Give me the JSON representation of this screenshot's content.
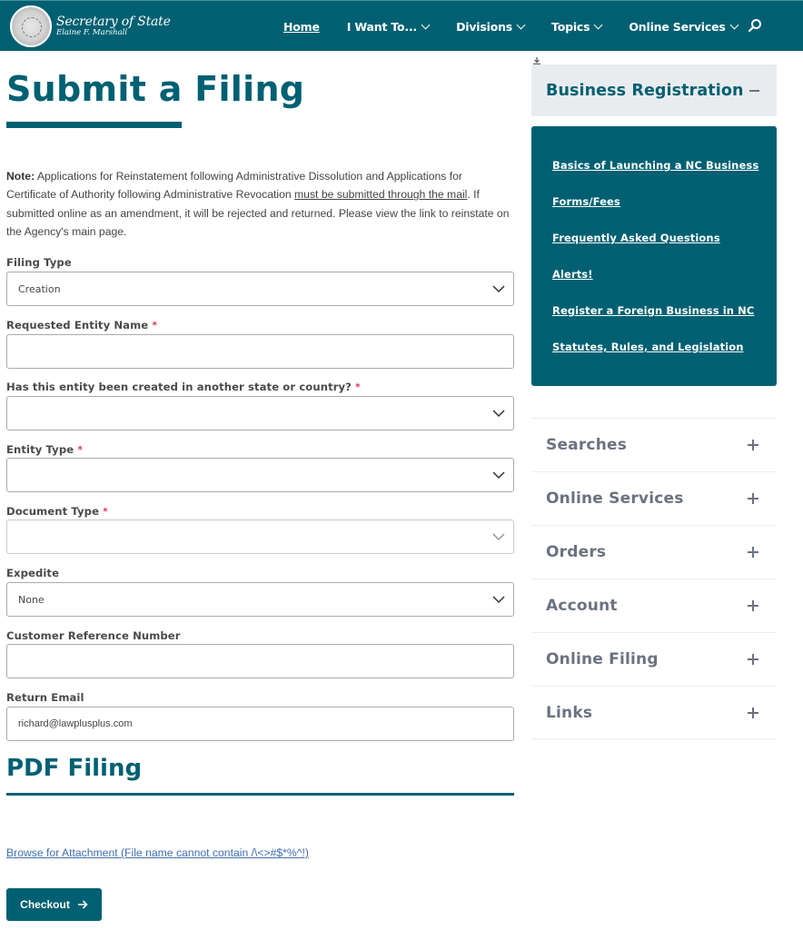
{
  "header": {
    "logo_title": "Secretary of State",
    "logo_subtitle": "Elaine F. Marshall",
    "brand_color": "#006072",
    "nav": [
      {
        "label": "Home",
        "active": true,
        "has_dropdown": false
      },
      {
        "label": "I Want To...",
        "active": false,
        "has_dropdown": true
      },
      {
        "label": "Divisions",
        "active": false,
        "has_dropdown": true
      },
      {
        "label": "Topics",
        "active": false,
        "has_dropdown": true
      },
      {
        "label": "Online Services",
        "active": false,
        "has_dropdown": true
      }
    ],
    "search_icon": "search-icon"
  },
  "main": {
    "title": "Submit a Filing",
    "note": {
      "prefix": "Note:",
      "text_1": " Applications for Reinstatement following Administrative Dissolution and Applications for Certificate of Authority following Administrative Revocation ",
      "emphasis": "must be submitted through the mail",
      "text_2": ". If submitted online as an amendment, it will be rejected and returned. Please view the link to reinstate on the Agency's main page."
    },
    "fields": [
      {
        "label": "Filing Type",
        "required": false,
        "type": "select",
        "value": "Creation",
        "placeholder": ""
      },
      {
        "label": "Requested Entity Name",
        "required": true,
        "type": "text",
        "value": "",
        "placeholder": ""
      },
      {
        "label": "Has this entity been created in another state or country?",
        "required": true,
        "type": "select",
        "value": "",
        "placeholder": ""
      },
      {
        "label": "Entity Type",
        "required": true,
        "type": "select",
        "value": "",
        "placeholder": ""
      },
      {
        "label": "Document Type",
        "required": true,
        "type": "select",
        "value": "",
        "placeholder": "",
        "disabled": true
      },
      {
        "label": "Expedite",
        "required": false,
        "type": "select",
        "value": "None",
        "placeholder": ""
      },
      {
        "label": "Customer Reference Number",
        "required": false,
        "type": "text",
        "value": "",
        "placeholder": ""
      },
      {
        "label": "Return Email",
        "required": false,
        "type": "text",
        "value": "richard@lawplusplus.com",
        "placeholder": ""
      }
    ],
    "required_marker": "*",
    "pdf_section_title": "PDF Filing",
    "attachment_link": "Browse for Attachment (File name cannot contain /\\<>#$*%^!)",
    "checkout_label": "Checkout"
  },
  "sidebar": {
    "expanded_section": {
      "title": "Business Registration",
      "links": [
        "Basics of Launching a NC Business",
        "Forms/Fees",
        "Frequently Asked Questions",
        "Alerts!",
        "Register a Foreign Business in NC",
        "Statutes, Rules, and Legislation"
      ]
    },
    "collapsed_sections": [
      "Searches",
      "Online Services",
      "Orders",
      "Account",
      "Online Filing",
      "Links"
    ]
  }
}
